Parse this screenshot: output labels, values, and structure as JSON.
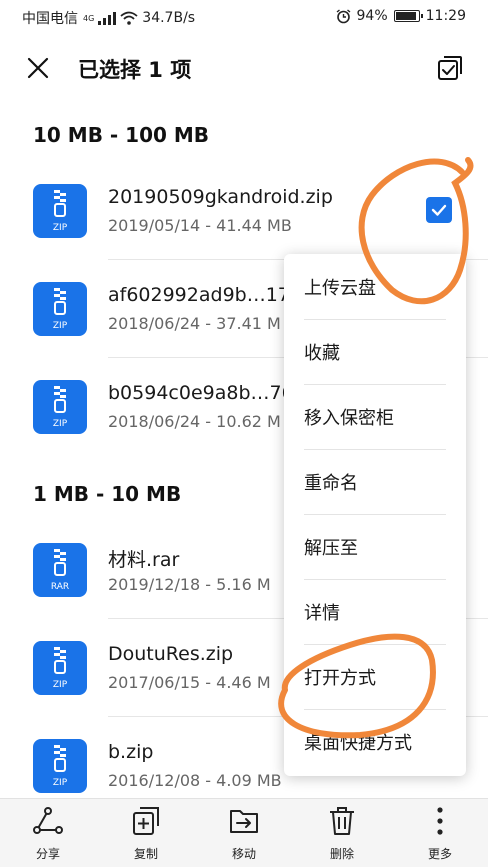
{
  "status_bar": {
    "carrier": "中国电信",
    "network": "4G",
    "speed": "34.7B/s",
    "battery": "94%",
    "battery_level": 0.94,
    "time": "11:29"
  },
  "header": {
    "title": "已选择 1 项"
  },
  "sections": [
    {
      "title": "10 MB - 100 MB",
      "files": [
        {
          "name": "20190509gkandroid.zip",
          "meta": "2019/05/14 - 41.44 MB",
          "ext": "ZIP",
          "selected": true
        },
        {
          "name": "af602992ad9b…17",
          "meta": "2018/06/24 - 37.41 M",
          "ext": "ZIP",
          "selected": false
        },
        {
          "name": "b0594c0e9a8b…76",
          "meta": "2018/06/24 - 10.62 M",
          "ext": "ZIP",
          "selected": false
        }
      ]
    },
    {
      "title": "1 MB - 10 MB",
      "files": [
        {
          "name": "材料.rar",
          "meta": "2019/12/18 - 5.16 M",
          "ext": "RAR",
          "selected": false
        },
        {
          "name": "DoutuRes.zip",
          "meta": "2017/06/15 - 4.46 M",
          "ext": "ZIP",
          "selected": false
        },
        {
          "name": "b.zip",
          "meta": "2016/12/08 - 4.09 MB",
          "ext": "ZIP",
          "selected": false
        }
      ]
    }
  ],
  "context_menu": {
    "items": [
      "上传云盘",
      "收藏",
      "移入保密柜",
      "重命名",
      "解压至",
      "详情",
      "打开方式",
      "桌面快捷方式"
    ]
  },
  "toolbar": {
    "items": [
      {
        "label": "分享",
        "icon": "share-icon"
      },
      {
        "label": "复制",
        "icon": "copy-icon"
      },
      {
        "label": "移动",
        "icon": "move-icon"
      },
      {
        "label": "删除",
        "icon": "delete-icon"
      },
      {
        "label": "更多",
        "icon": "more-icon"
      }
    ]
  },
  "colors": {
    "accent": "#1a73e8",
    "annotation": "#f0873a"
  }
}
